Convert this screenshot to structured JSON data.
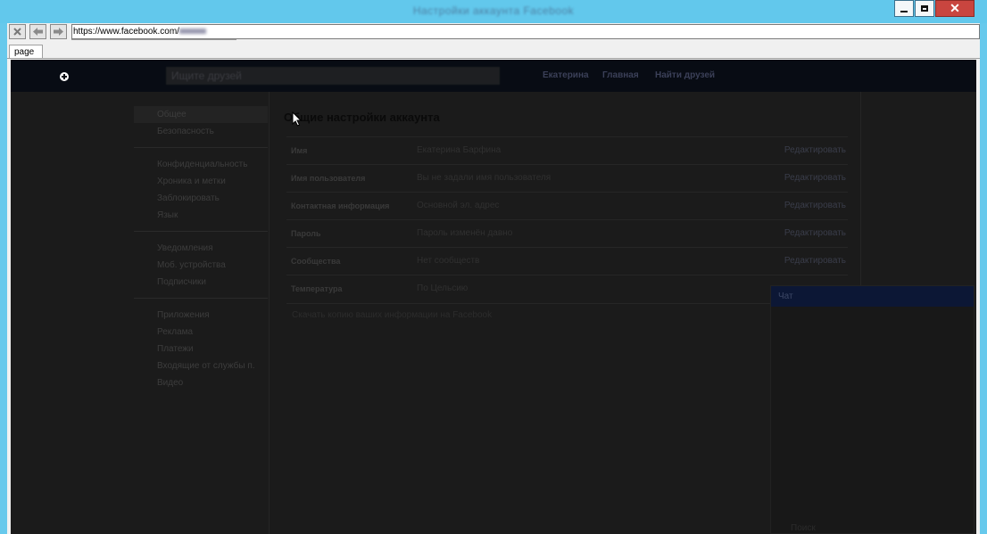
{
  "window": {
    "title": "Настройки аккаунта Facebook",
    "close_glyph": "✕"
  },
  "browser": {
    "address": "https://www.facebook.com/",
    "tab_label": "page",
    "icons": [
      "stop-icon",
      "back-icon",
      "forward-icon"
    ]
  },
  "fb": {
    "search_placeholder": "Ищите друзей",
    "nav": [
      "Екатерина",
      "Главная",
      "Найти друзей"
    ]
  },
  "sidebar": {
    "groups": [
      [
        "Общее",
        "Безопасность"
      ],
      [
        "Конфиденциальность",
        "Хроника и метки",
        "Заблокировать",
        "Язык"
      ],
      [
        "Уведомления",
        "Моб. устройства",
        "Подписчики"
      ],
      [
        "Приложения",
        "Реклама",
        "Платежи",
        "Входящие от службы п.",
        "Видео"
      ]
    ]
  },
  "settings": {
    "title": "Общие настройки аккаунта",
    "edit_label": "Редактировать",
    "rows": [
      {
        "label": "Имя",
        "value": "Екатерина Барфина"
      },
      {
        "label": "Имя пользователя",
        "value": "Вы не задали имя пользователя"
      },
      {
        "label": "Контактная информация",
        "value": "Основной эл. адрес"
      },
      {
        "label": "Пароль",
        "value": "Пароль изменён давно"
      },
      {
        "label": "Сообщества",
        "value": "Нет сообществ"
      },
      {
        "label": "Температура",
        "value": "По Цельсию"
      }
    ],
    "download_text": "Скачать копию ваших информации на Facebook"
  },
  "chat": {
    "header": "Чат",
    "footer": "Поиск"
  }
}
